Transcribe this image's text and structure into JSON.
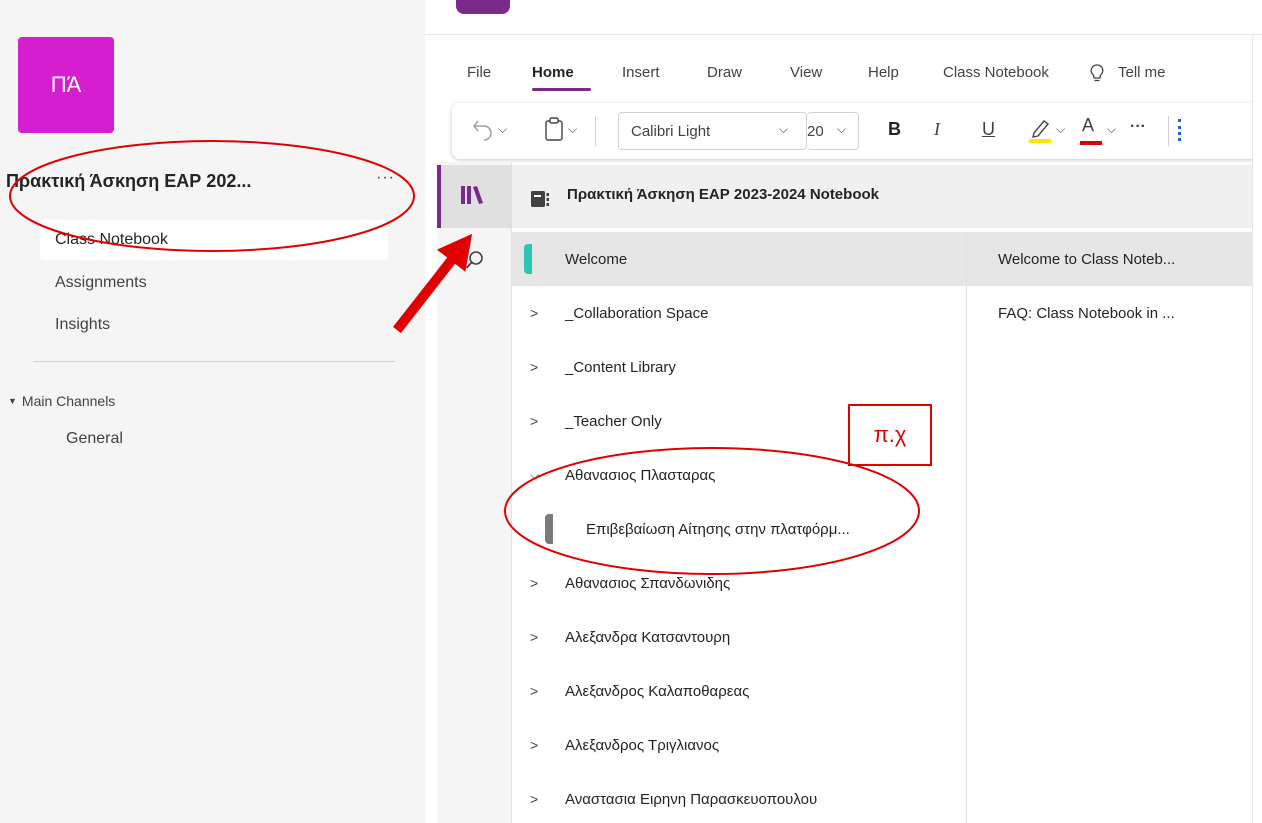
{
  "team": {
    "avatar_initials": "ΠΆ",
    "name": "Πρακτική Άσκηση ΕΑΡ 202...",
    "more": "···",
    "nav": [
      "Class Notebook",
      "Assignments",
      "Insights"
    ],
    "channels_header": "Main Channels",
    "channels": [
      "General"
    ]
  },
  "menu": {
    "items": [
      "File",
      "Home",
      "Insert",
      "Draw",
      "View",
      "Help",
      "Class Notebook"
    ],
    "tell_me": "Tell me"
  },
  "ribbon": {
    "font_name": "Calibri Light",
    "font_size": "20",
    "bold": "B",
    "italic": "I",
    "underline": "U",
    "font_color_glyph": "A",
    "more": "···"
  },
  "notebook": {
    "title": "Πρακτική Άσκηση ΕΑΡ 2023-2024 Notebook"
  },
  "sections": [
    {
      "label": "Welcome",
      "type": "section",
      "color": "#2ec4b6"
    },
    {
      "label": "_Collaboration Space",
      "type": "group"
    },
    {
      "label": "_Content Library",
      "type": "group"
    },
    {
      "label": "_Teacher Only",
      "type": "group"
    },
    {
      "label": "Αθανασιος Πλασταρας",
      "type": "group-expanded"
    },
    {
      "label": "Επιβεβαίωση Αίτησης στην πλατφόρμ...",
      "type": "page-section"
    },
    {
      "label": "Αθανασιος Σπανδωνιδης",
      "type": "group"
    },
    {
      "label": "Αλεξανδρα Κατσαντουρη",
      "type": "group"
    },
    {
      "label": "Αλεξανδρος Καλαποθαρεας",
      "type": "group"
    },
    {
      "label": "Αλεξανδρος Τριγλιανος",
      "type": "group"
    },
    {
      "label": "Αναστασια Ειρηνη Παρασκευοπουλου",
      "type": "group"
    }
  ],
  "pages": [
    "Welcome to Class Noteb...",
    "FAQ: Class Notebook in ..."
  ],
  "annotation": {
    "label": "π.χ"
  },
  "colors": {
    "accent": "#7b2a8c",
    "avatar": "#d41ecf",
    "annotation": "#e00000",
    "highlighter": "#ffe600",
    "font_color": "#e00000"
  },
  "icons": [
    "library-icon",
    "search-icon",
    "notebook-icon",
    "undo-icon",
    "clipboard-icon",
    "highlighter-icon",
    "lightbulb-icon",
    "chevron-right-icon"
  ]
}
